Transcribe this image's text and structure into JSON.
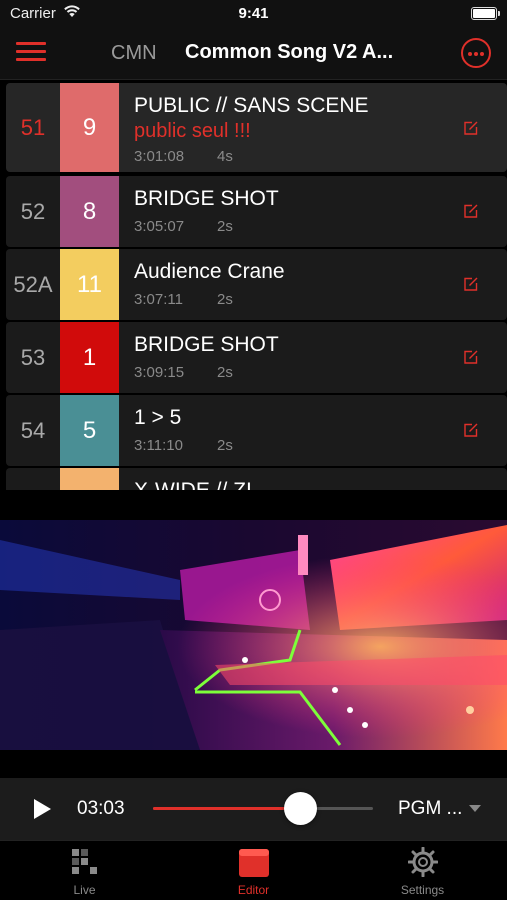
{
  "status_bar": {
    "carrier": "Carrier",
    "time": "9:41"
  },
  "nav": {
    "short_name": "CMN",
    "title": "Common Song V2 A..."
  },
  "colors": {
    "accent": "#e0302a",
    "background": "#000000",
    "row": "#1b1b1b",
    "text_muted": "#8a8a8a"
  },
  "shots": [
    {
      "number": "51",
      "shot": "9",
      "color": "#df6b6b",
      "name": "PUBLIC // SANS SCENE",
      "note": "public seul !!!",
      "timecode": "3:01:08",
      "duration": "4s",
      "active": true
    },
    {
      "number": "52",
      "shot": "8",
      "color": "#a24e7e",
      "name": "BRIDGE SHOT",
      "note": "",
      "timecode": "3:05:07",
      "duration": "2s",
      "active": false
    },
    {
      "number": "52A",
      "shot": "11",
      "color": "#f3cd5f",
      "name": "Audience Crane",
      "note": "",
      "timecode": "3:07:11",
      "duration": "2s",
      "active": false
    },
    {
      "number": "53",
      "shot": "1",
      "color": "#d10b0b",
      "name": "BRIDGE SHOT",
      "note": "",
      "timecode": "3:09:15",
      "duration": "2s",
      "active": false
    },
    {
      "number": "54",
      "shot": "5",
      "color": "#4a8f95",
      "name": "1 > 5",
      "note": "",
      "timecode": "3:11:10",
      "duration": "2s",
      "active": false
    },
    {
      "number": "",
      "shot": "",
      "color": "#f3b26e",
      "name": "X-WIDE // ZI",
      "note": "",
      "timecode": "",
      "duration": "",
      "active": false
    }
  ],
  "player": {
    "time": "03:03",
    "source": "PGM ...",
    "progress": 0.67
  },
  "tabs": [
    {
      "label": "Live",
      "icon": "live-grid-icon",
      "active": false
    },
    {
      "label": "Editor",
      "icon": "editor-icon",
      "active": true
    },
    {
      "label": "Settings",
      "icon": "gear-icon",
      "active": false
    }
  ]
}
